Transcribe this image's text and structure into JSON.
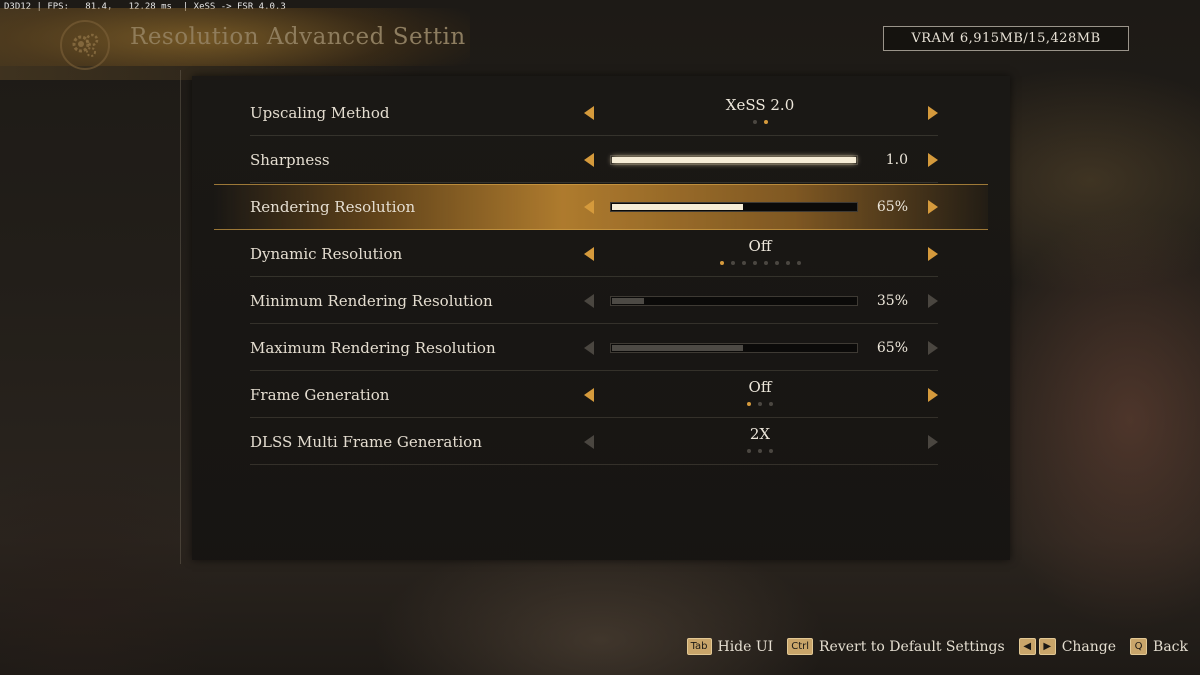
{
  "debug_overlay": "D3D12 | FPS:   81.4,   12.28 ms  | XeSS -> FSR 4.0.3",
  "page_title": "Resolution Advanced Settin",
  "vram": "VRAM 6,915MB/15,428MB",
  "colors": {
    "accent": "#d59a3c",
    "dim": "#4a4640",
    "selected_row": "#c88c32"
  },
  "settings": [
    {
      "label": "Upscaling Method",
      "type": "option",
      "value": "XeSS 2.0",
      "dots": 2,
      "active_dot": 2,
      "enabled": true
    },
    {
      "label": "Sharpness",
      "type": "slider",
      "value": "1.0",
      "fraction": 1.0,
      "enabled": true
    },
    {
      "label": "Rendering Resolution",
      "type": "slider",
      "value": "65%",
      "fraction": 0.54,
      "enabled": true,
      "selected": true
    },
    {
      "label": "Dynamic Resolution",
      "type": "option",
      "value": "Off",
      "dots": 8,
      "active_dot": 1,
      "enabled": true
    },
    {
      "label": "Minimum Rendering Resolution",
      "type": "slider",
      "value": "35%",
      "fraction": 0.14,
      "enabled": false
    },
    {
      "label": "Maximum Rendering Resolution",
      "type": "slider",
      "value": "65%",
      "fraction": 0.54,
      "enabled": false
    },
    {
      "label": "Frame Generation",
      "type": "option",
      "value": "Off",
      "dots": 3,
      "active_dot": 1,
      "enabled": true
    },
    {
      "label": "DLSS Multi Frame Generation",
      "type": "option",
      "value": "2X",
      "dots": 3,
      "active_dot": 0,
      "enabled": false
    }
  ],
  "footer": {
    "hide_key": "Tab",
    "hide_label": "Hide UI",
    "revert_key": "Ctrl",
    "revert_label": "Revert to Default Settings",
    "change_left_key": "◀",
    "change_right_key": "▶",
    "change_label": "Change",
    "back_key": "Q",
    "back_label": "Back"
  }
}
